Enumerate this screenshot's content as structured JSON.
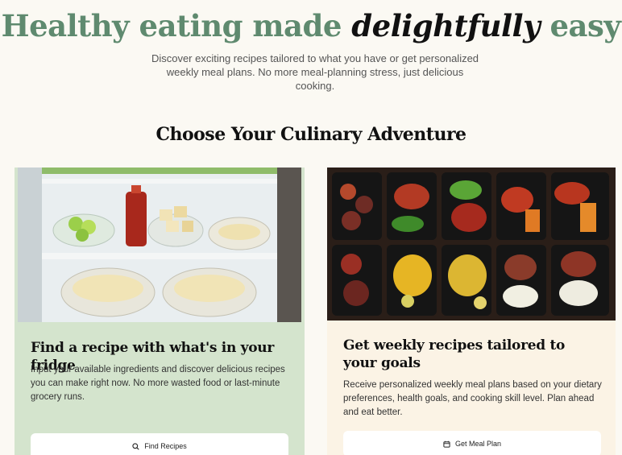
{
  "hero": {
    "title_start": "Healthy eating made ",
    "title_emphasis": "delightfully",
    "title_end": " easy",
    "subtitle": "Discover exciting recipes tailored to what you have or get personalized weekly meal plans. No more meal-planning stress, just delicious cooking."
  },
  "section": {
    "title": "Choose Your Culinary Adventure"
  },
  "cards": [
    {
      "heading": "Find a recipe with what's in your fridge",
      "description": "Input your available ingredients and discover delicious recipes you can make right now. No more wasted food or last-minute grocery runs.",
      "button_label": "Find Recipes",
      "button_icon": "search-icon",
      "background": "#d4e4cd"
    },
    {
      "heading": "Get weekly recipes tailored to your goals",
      "description": "Receive personalized weekly meal plans based on your dietary preferences, health goals, and cooking skill level. Plan ahead and eat better.",
      "button_label": "Get Meal Plan",
      "button_icon": "calendar-icon",
      "background": "#fbf3e5"
    }
  ],
  "colors": {
    "accent": "#5f8a6f",
    "page_bg": "#fbf9f3"
  }
}
